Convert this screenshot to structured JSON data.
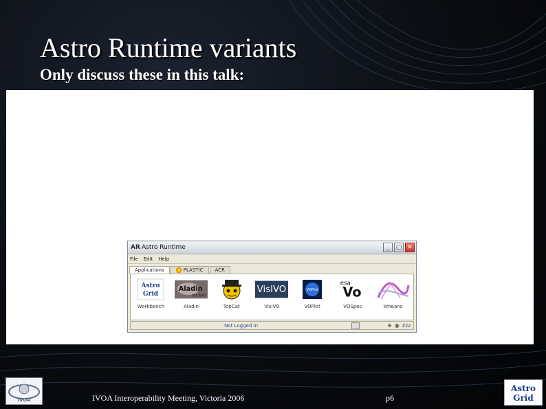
{
  "slide": {
    "title": "Astro Runtime variants",
    "subtitle": "Only discuss these in this talk:"
  },
  "window": {
    "title": "Astro Runtime",
    "menu": [
      "File",
      "Edit",
      "Help"
    ],
    "tabs": [
      {
        "label": "Applications",
        "active": true
      },
      {
        "label": "PLASTIC",
        "active": false
      },
      {
        "label": "ACR",
        "active": false
      }
    ],
    "apps": [
      {
        "label": "Workbench",
        "logo_text": "Astro Grid"
      },
      {
        "label": "Aladin",
        "logo_text": "Aladin",
        "logo_sub": "for AVO"
      },
      {
        "label": "TopCat",
        "logo_text": ""
      },
      {
        "label": "VisIVO",
        "logo_text": "VisIVO"
      },
      {
        "label": "VOPlot",
        "logo_text": "VOPlot"
      },
      {
        "label": "VOSpec",
        "logo_text": "Vo",
        "logo_sub": "esa"
      },
      {
        "label": "kmeans"
      }
    ],
    "status": {
      "text": "Not Logged In",
      "zzz": "Zzz"
    }
  },
  "footer": {
    "meeting": "IVOA Interoperability Meeting, Victoria 2006",
    "page": "p6",
    "astrogrid_logo_text": "Astro Grid"
  },
  "colors": {
    "accent_blue": "#2a4fa0",
    "close_red": "#c0392b"
  }
}
